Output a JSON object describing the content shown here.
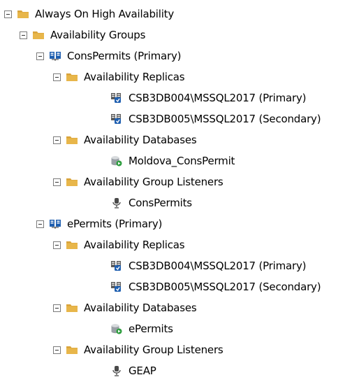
{
  "colors": {
    "folder": "#e8b64a",
    "folder_tab": "#d9a33a",
    "server_blue": "#1f5fb0",
    "db_gray": "#9aa0a6",
    "db_green": "#2e9e3f",
    "listener": "#4a4a4a"
  },
  "tree": {
    "root": {
      "label": "Always On High Availability",
      "icon": "folder-icon"
    },
    "availability_groups": {
      "label": "Availability Groups",
      "icon": "folder-icon"
    },
    "groups": [
      {
        "label": "ConsPermits (Primary)",
        "icon": "availability-group-icon",
        "replicas_label": "Availability Replicas",
        "replicas": [
          {
            "label": "CSB3DB004\\MSSQL2017 (Primary)",
            "icon": "replica-server-icon"
          },
          {
            "label": "CSB3DB005\\MSSQL2017 (Secondary)",
            "icon": "replica-server-icon"
          }
        ],
        "databases_label": "Availability Databases",
        "databases": [
          {
            "label": "Moldova_ConsPermit",
            "icon": "database-icon"
          }
        ],
        "listeners_label": "Availability Group Listeners",
        "listeners": [
          {
            "label": "ConsPermits",
            "icon": "listener-icon"
          }
        ]
      },
      {
        "label": "ePermits (Primary)",
        "icon": "availability-group-icon",
        "replicas_label": "Availability Replicas",
        "replicas": [
          {
            "label": "CSB3DB004\\MSSQL2017 (Primary)",
            "icon": "replica-server-icon"
          },
          {
            "label": "CSB3DB005\\MSSQL2017 (Secondary)",
            "icon": "replica-server-icon"
          }
        ],
        "databases_label": "Availability Databases",
        "databases": [
          {
            "label": "ePermits",
            "icon": "database-icon"
          }
        ],
        "listeners_label": "Availability Group Listeners",
        "listeners": [
          {
            "label": "GEAP",
            "icon": "listener-icon"
          }
        ]
      }
    ]
  }
}
